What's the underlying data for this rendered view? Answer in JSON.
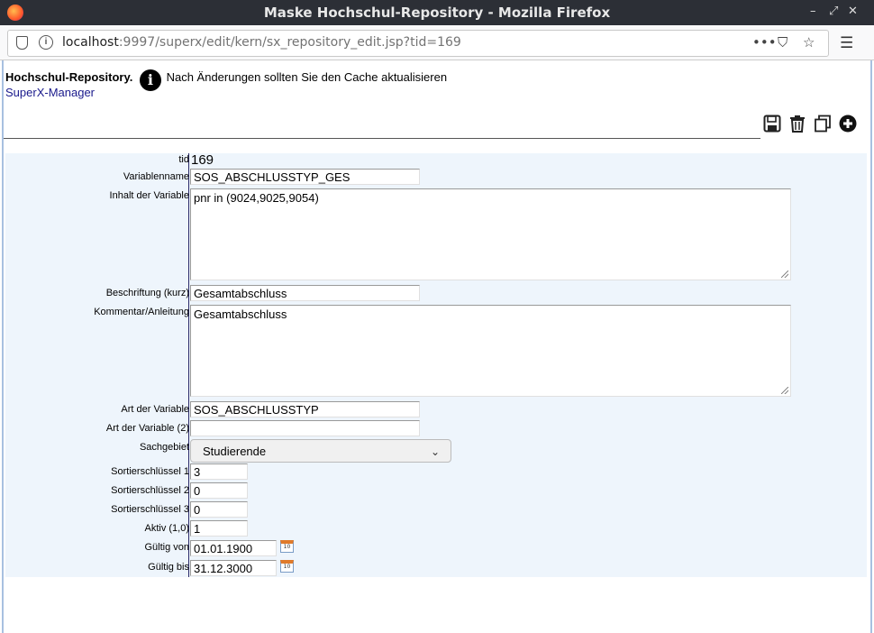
{
  "window": {
    "title": "Maske Hochschul-Repository - Mozilla Firefox"
  },
  "browser": {
    "url_host": "localhost",
    "url_rest": ":9997/superx/edit/kern/sx_repository_edit.jsp?tid=169"
  },
  "header": {
    "title": "Hochschul-Repository.",
    "hint": "Nach Änderungen sollten Sie den Cache aktualisieren",
    "manager_link": "SuperX-Manager"
  },
  "form": {
    "tid": {
      "label": "tid",
      "value": "169"
    },
    "variablenname": {
      "label": "Variablenname",
      "value": "SOS_ABSCHLUSSTYP_GES"
    },
    "inhalt": {
      "label": "Inhalt der Variable",
      "value": "pnr in (9024,9025,9054)"
    },
    "beschriftung": {
      "label": "Beschriftung (kurz)",
      "value": "Gesamtabschluss"
    },
    "kommentar": {
      "label": "Kommentar/Anleitung",
      "value": "Gesamtabschluss"
    },
    "art": {
      "label": "Art der Variable",
      "value": "SOS_ABSCHLUSSTYP"
    },
    "art2": {
      "label": "Art der Variable (2)",
      "value": ""
    },
    "sachgebiet": {
      "label": "Sachgebiet",
      "value": "Studierende"
    },
    "sort1": {
      "label": "Sortierschlüssel 1",
      "value": "3"
    },
    "sort2": {
      "label": "Sortierschlüssel 2",
      "value": "0"
    },
    "sort3": {
      "label": "Sortierschlüssel 3",
      "value": "0"
    },
    "aktiv": {
      "label": "Aktiv (1,0)",
      "value": "1"
    },
    "gueltig_von": {
      "label": "Gültig von",
      "value": "01.01.1900"
    },
    "gueltig_bis": {
      "label": "Gültig bis",
      "value": "31.12.3000"
    }
  },
  "icons": {
    "save": "save-icon",
    "delete": "trash-icon",
    "copy": "copy-icon",
    "add": "plus-icon",
    "calendar_day": "10"
  }
}
